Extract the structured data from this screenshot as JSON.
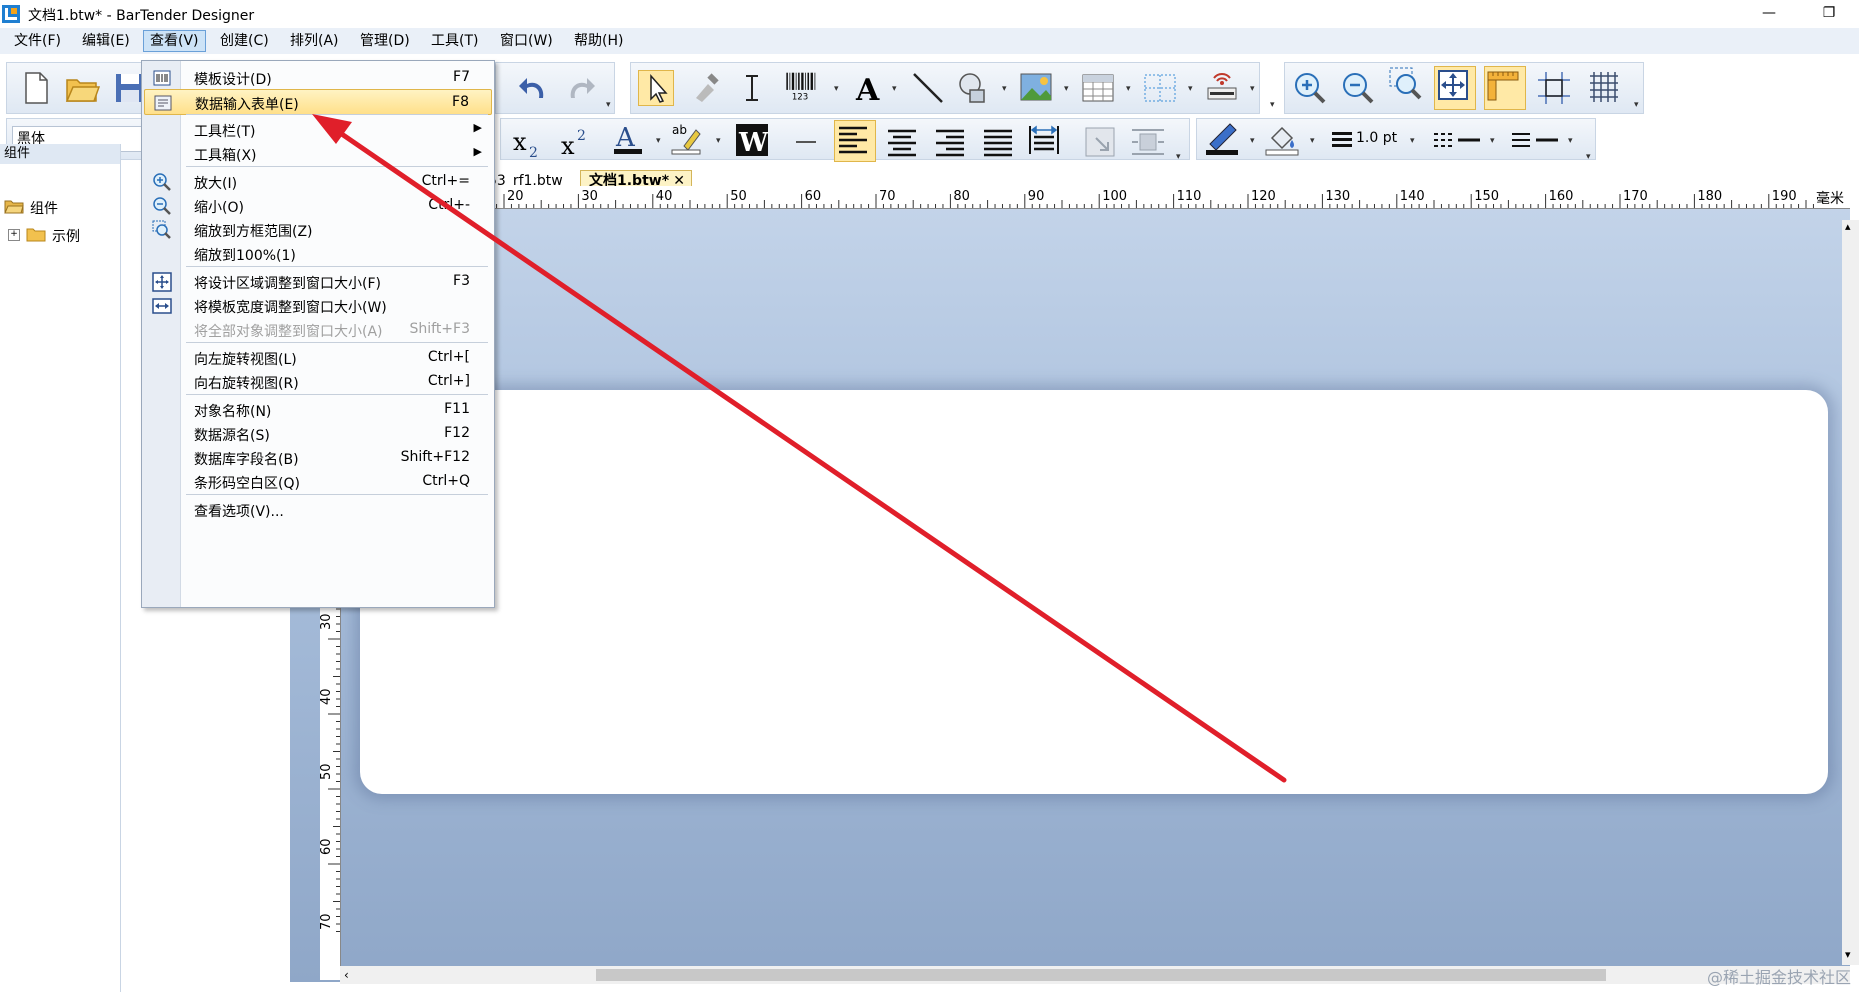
{
  "window": {
    "title": "文档1.btw* - BarTender Designer",
    "minimize": "—",
    "restore": "❐"
  },
  "menubar": [
    {
      "label": "文件(F)"
    },
    {
      "label": "编辑(E)"
    },
    {
      "label": "查看(V)"
    },
    {
      "label": "创建(C)"
    },
    {
      "label": "排列(A)"
    },
    {
      "label": "管理(D)"
    },
    {
      "label": "工具(T)"
    },
    {
      "label": "窗口(W)"
    },
    {
      "label": "帮助(H)"
    }
  ],
  "format_toolbar": {
    "font_name": "黑体",
    "line_width": "1.0 pt"
  },
  "left_panel": {
    "header": "组件",
    "tree_root": "组件",
    "tree_child": "示例"
  },
  "tabs": [
    {
      "label": "53_rf1.btw"
    },
    {
      "label": "文档1.btw*",
      "close": "✕"
    }
  ],
  "ruler": {
    "unit": "毫米",
    "h_ticks": [
      "20",
      "30",
      "40",
      "50",
      "60",
      "70",
      "80",
      "90",
      "100",
      "110",
      "120",
      "130",
      "140",
      "150",
      "160",
      "170",
      "180",
      "190"
    ],
    "v_ticks": [
      "30",
      "40",
      "50",
      "60",
      "70"
    ]
  },
  "view_menu": {
    "items": [
      {
        "label": "模板设计(D)",
        "shortcut": "F7",
        "icon": "template-design-icon"
      },
      {
        "label": "数据输入表单(E)",
        "shortcut": "F8",
        "icon": "data-entry-form-icon",
        "highlighted": true
      },
      {
        "label": "工具栏(T)",
        "shortcut": "",
        "submenu": true
      },
      {
        "label": "工具箱(X)",
        "shortcut": "",
        "submenu": true
      },
      {
        "label": "放大(I)",
        "shortcut": "Ctrl+=",
        "icon": "zoom-in-icon"
      },
      {
        "label": "缩小(O)",
        "shortcut": "Ctrl+-",
        "icon": "zoom-out-icon"
      },
      {
        "label": "缩放到方框范围(Z)",
        "shortcut": "",
        "icon": "zoom-box-icon"
      },
      {
        "label": "缩放到100%(1)",
        "shortcut": ""
      },
      {
        "label": "将设计区域调整到窗口大小(F)",
        "shortcut": "F3",
        "icon": "fit-design-icon"
      },
      {
        "label": "将模板宽度调整到窗口大小(W)",
        "shortcut": "",
        "icon": "fit-width-icon"
      },
      {
        "label": "将全部对象调整到窗口大小(A)",
        "shortcut": "Shift+F3",
        "disabled": true
      },
      {
        "label": "向左旋转视图(L)",
        "shortcut": "Ctrl+["
      },
      {
        "label": "向右旋转视图(R)",
        "shortcut": "Ctrl+]"
      },
      {
        "label": "对象名称(N)",
        "shortcut": "F11"
      },
      {
        "label": "数据源名(S)",
        "shortcut": "F12"
      },
      {
        "label": "数据库字段名(B)",
        "shortcut": "Shift+F12"
      },
      {
        "label": "条形码空白区(Q)",
        "shortcut": "Ctrl+Q"
      },
      {
        "label": "查看选项(V)...",
        "shortcut": ""
      }
    ]
  },
  "watermark": "@稀土掘金技术社区",
  "colors": {
    "annotation_arrow": "#e01f2a",
    "menu_highlight": "#ffe08a",
    "canvas_top": "#c5d5ea",
    "canvas_bottom": "#8fa7c8"
  }
}
